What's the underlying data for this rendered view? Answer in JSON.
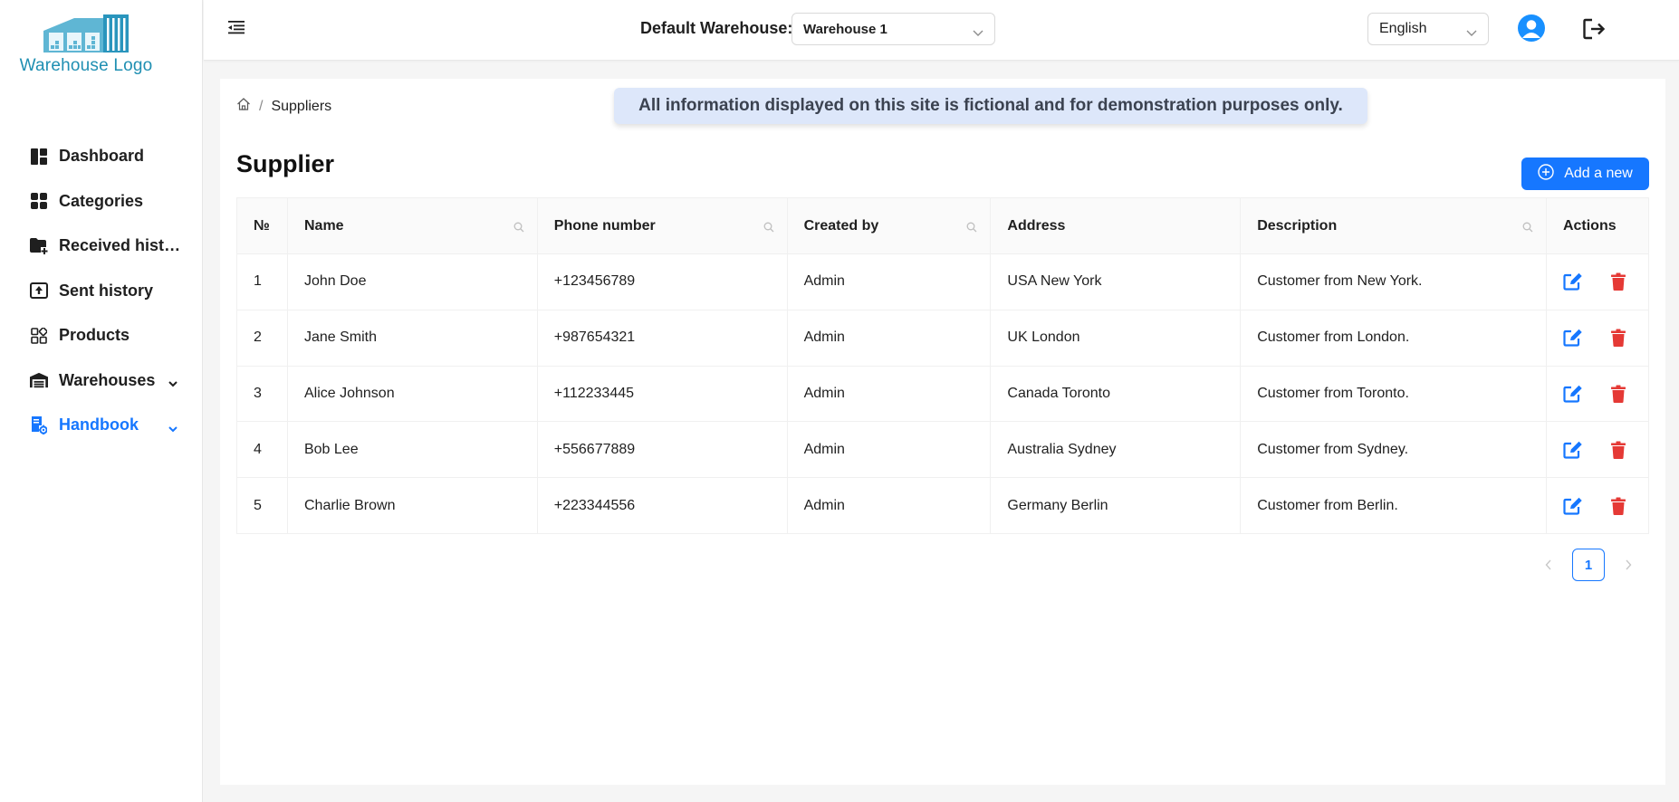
{
  "logo": {
    "text": "Warehouse Logo"
  },
  "sidebar": {
    "items": [
      {
        "label": "Dashboard",
        "icon": "dashboard-icon"
      },
      {
        "label": "Categories",
        "icon": "categories-icon"
      },
      {
        "label": "Received history",
        "icon": "folder-plus-icon"
      },
      {
        "label": "Sent history",
        "icon": "upload-box-icon"
      },
      {
        "label": "Products",
        "icon": "products-icon"
      },
      {
        "label": "Warehouses",
        "icon": "warehouse-icon",
        "expandable": true
      },
      {
        "label": "Handbook",
        "icon": "handbook-icon",
        "expandable": true,
        "active": true
      }
    ]
  },
  "header": {
    "default_warehouse_label": "Default Warehouse:",
    "warehouse_selected": "Warehouse 1",
    "language_selected": "English"
  },
  "breadcrumb": {
    "current": "Suppliers"
  },
  "notice": "All information displayed on this site is fictional and for demonstration purposes only.",
  "page": {
    "title": "Supplier",
    "add_button_label": "Add a new"
  },
  "table": {
    "columns": [
      "№",
      "Name",
      "Phone number",
      "Created by",
      "Address",
      "Description",
      "Actions"
    ],
    "rows": [
      {
        "no": "1",
        "name": "John Doe",
        "phone": "+123456789",
        "created_by": "Admin",
        "address": "USA New York",
        "description": "Customer from New York."
      },
      {
        "no": "2",
        "name": "Jane Smith",
        "phone": "+987654321",
        "created_by": "Admin",
        "address": "UK London",
        "description": "Customer from London."
      },
      {
        "no": "3",
        "name": "Alice Johnson",
        "phone": "+112233445",
        "created_by": "Admin",
        "address": "Canada Toronto",
        "description": "Customer from Toronto."
      },
      {
        "no": "4",
        "name": "Bob Lee",
        "phone": "+556677889",
        "created_by": "Admin",
        "address": "Australia Sydney",
        "description": "Customer from Sydney."
      },
      {
        "no": "5",
        "name": "Charlie Brown",
        "phone": "+223344556",
        "created_by": "Admin",
        "address": "Germany Berlin",
        "description": "Customer from Berlin."
      }
    ]
  },
  "pagination": {
    "current_page": "1"
  },
  "colors": {
    "primary": "#1677ff",
    "delete": "#e53935",
    "logo": "#1f8fb2",
    "notice_bg": "#dde7fa"
  }
}
